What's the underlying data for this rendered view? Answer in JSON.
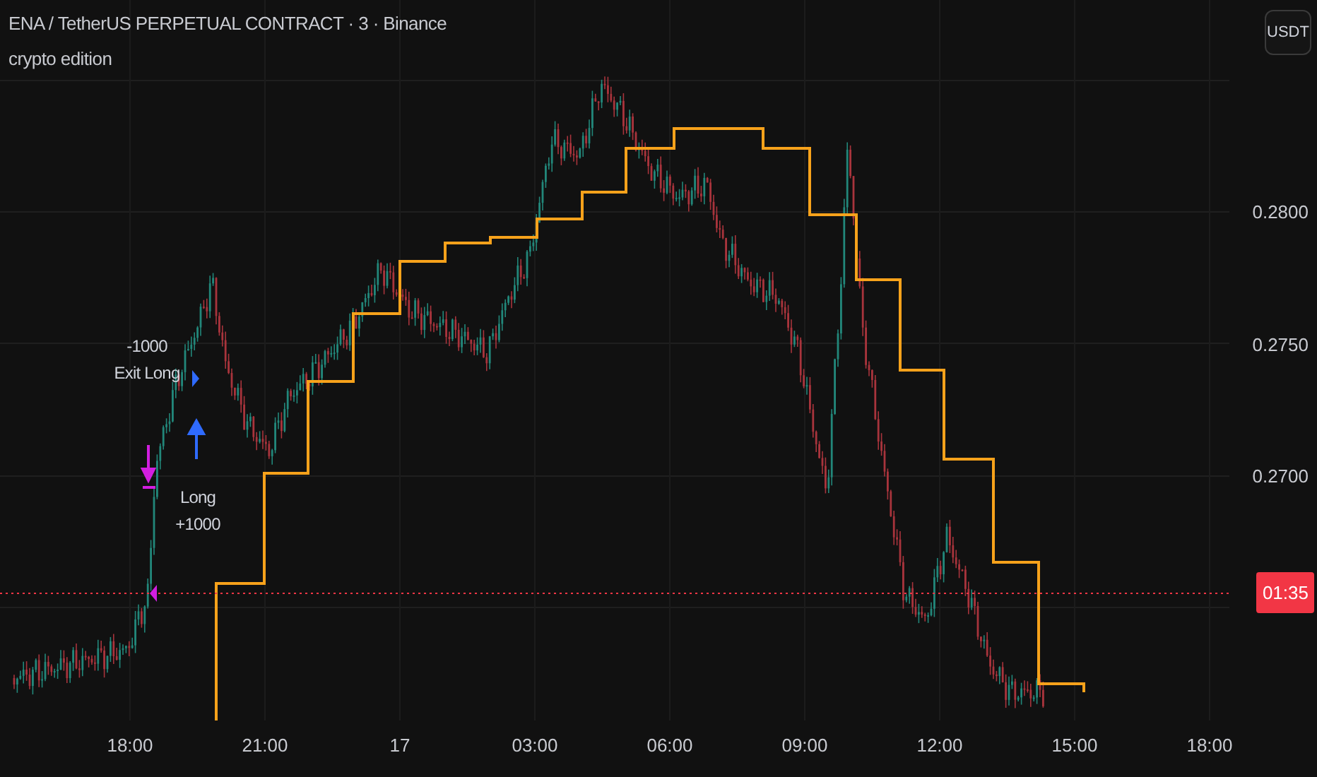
{
  "legend": {
    "title": "ENA / TetherUS PERPETUAL CONTRACT · 3 · Binance",
    "subtitle": "crypto edition"
  },
  "currency_button": "USDT",
  "price_axis": [
    "0.2800",
    "0.2750",
    "0.2700"
  ],
  "countdown": "01:35",
  "time_axis": [
    "18:00",
    "21:00",
    "17",
    "03:00",
    "06:00",
    "09:00",
    "12:00",
    "15:00",
    "18:00"
  ],
  "trade_labels": [
    {
      "kind": "exit",
      "lines": [
        "-1000",
        "Exit Long"
      ]
    },
    {
      "kind": "entry",
      "lines": [
        "Long",
        "+1000"
      ]
    }
  ]
}
